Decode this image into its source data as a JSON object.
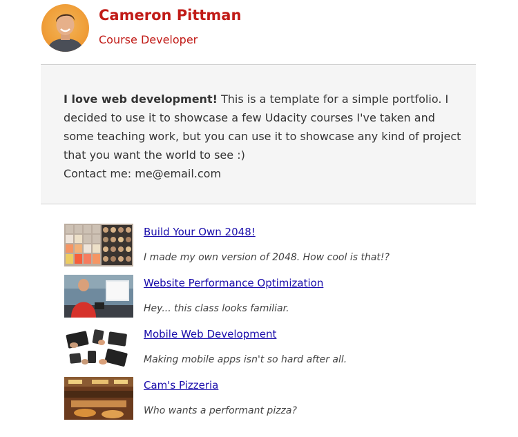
{
  "profile": {
    "name": "Cameron Pittman",
    "role": "Course Developer"
  },
  "about": {
    "lead": "I love web development!",
    "body": " This is a template for a simple portfolio. I decided to use it to showcase a few Udacity courses I've taken and some teaching work, but you can use it to showcase any kind of project that you want the world to see :)",
    "contact": "Contact me: me@email.com"
  },
  "projects": [
    {
      "title": "Build Your Own 2048!",
      "description": "I made my own version of 2048. How cool is that!?",
      "thumb_icon": "game-2048-thumbnail"
    },
    {
      "title": "Website Performance Optimization",
      "description": "Hey... this class looks familiar.",
      "thumb_icon": "presenter-thumbnail"
    },
    {
      "title": "Mobile Web Development",
      "description": "Making mobile apps isn't so hard after all.",
      "thumb_icon": "hands-devices-thumbnail"
    },
    {
      "title": "Cam's Pizzeria",
      "description": "Who wants a performant pizza?",
      "thumb_icon": "pizzeria-thumbnail"
    }
  ],
  "colors": {
    "accent": "#c11b17",
    "link": "#1a0dab",
    "panel_bg": "#f5f5f5"
  }
}
